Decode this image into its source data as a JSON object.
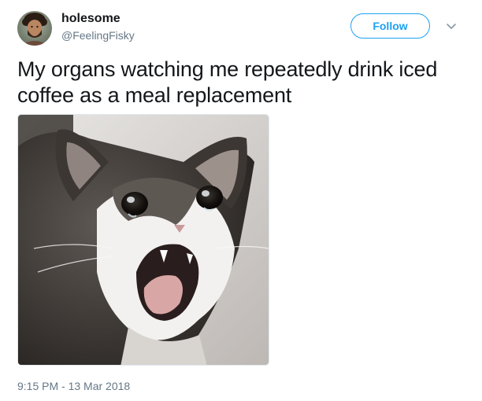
{
  "user": {
    "display_name": "holesome",
    "handle": "@FeelingFisky",
    "avatar_icon": "user-avatar-photo"
  },
  "actions": {
    "follow_label": "Follow",
    "menu_icon": "chevron-down-icon"
  },
  "tweet": {
    "text": "My organs watching me repeatedly drink iced coffee as a meal replacement",
    "media_icon": "crying-cat-photo",
    "timestamp": "9:15 PM - 13 Mar 2018"
  },
  "colors": {
    "accent": "#1da1f2",
    "text_primary": "#14171a",
    "text_secondary": "#657786"
  }
}
